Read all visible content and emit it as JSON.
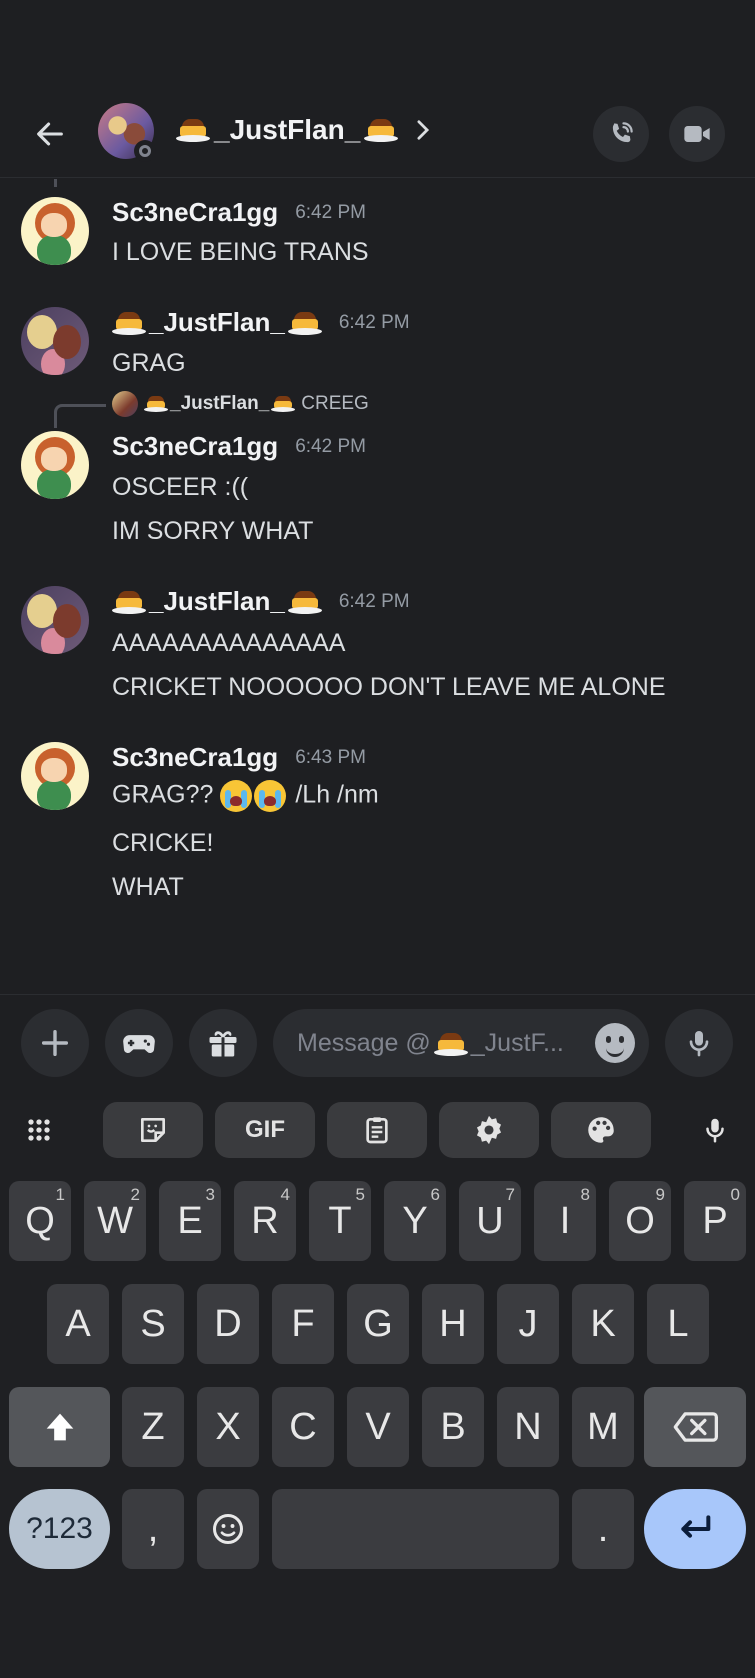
{
  "header": {
    "title_prefix": "_JustFlan_",
    "title_suffix": ""
  },
  "messages": [
    {
      "author": "Sc3neCra1gg",
      "time": "6:42 PM",
      "lines": [
        "I LOVE BEING TRANS"
      ]
    },
    {
      "author": "_JustFlan_",
      "time": "6:42 PM",
      "lines": [
        "GRAG"
      ]
    },
    {
      "reply_to": "_JustFlan_",
      "reply_text": "CREEG",
      "author": "Sc3neCra1gg",
      "time": "6:42 PM",
      "lines": [
        "OSCEER :((",
        "IM SORRY WHAT"
      ]
    },
    {
      "author": "_JustFlan_",
      "time": "6:42 PM",
      "lines": [
        "AAAAAAAAAAAAAA",
        "CRICKET NOOOOOO DON'T LEAVE ME ALONE"
      ]
    },
    {
      "author": "Sc3neCra1gg",
      "time": "6:43 PM",
      "lines": [
        "GRAG??",
        "/Lh /nm",
        "CRICKE!",
        "WHAT"
      ]
    }
  ],
  "input": {
    "placeholder_prefix": "Message @",
    "placeholder_suffix": "_JustF..."
  },
  "keyboard": {
    "toolbar": {
      "gif": "GIF"
    },
    "row1": [
      [
        "Q",
        "1"
      ],
      [
        "W",
        "2"
      ],
      [
        "E",
        "3"
      ],
      [
        "R",
        "4"
      ],
      [
        "T",
        "5"
      ],
      [
        "Y",
        "6"
      ],
      [
        "U",
        "7"
      ],
      [
        "I",
        "8"
      ],
      [
        "O",
        "9"
      ],
      [
        "P",
        "0"
      ]
    ],
    "row2": [
      "A",
      "S",
      "D",
      "F",
      "G",
      "H",
      "J",
      "K",
      "L"
    ],
    "row3": [
      "Z",
      "X",
      "C",
      "V",
      "B",
      "N",
      "M"
    ],
    "symbols": "?123",
    "comma": ",",
    "period": "."
  },
  "icons": {
    "back": "arrow-left-icon",
    "call": "phone-call-icon",
    "video": "video-camera-icon",
    "add": "plus-icon",
    "games": "gamepad-icon",
    "gift": "gift-icon",
    "mic": "microphone-icon"
  }
}
